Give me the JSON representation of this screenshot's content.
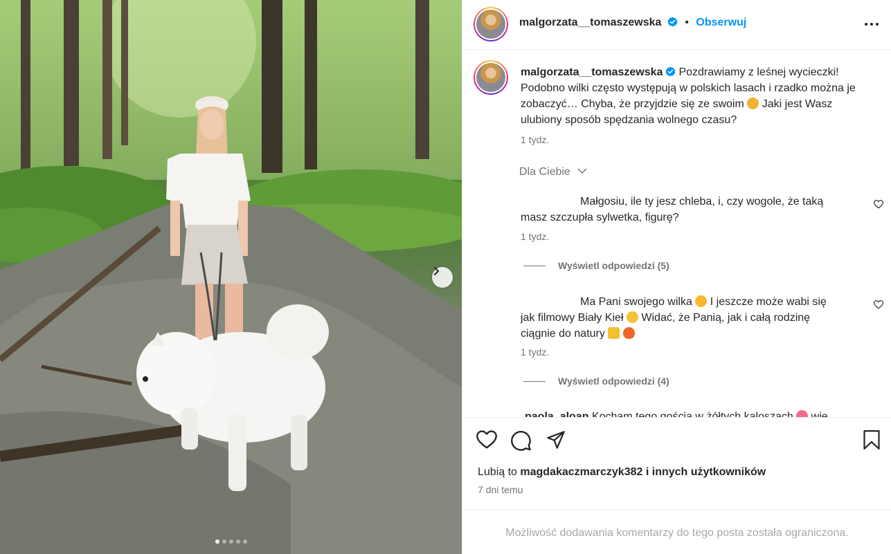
{
  "post": {
    "username": "malgorzata__tomaszewska",
    "follow_label": "Obserwuj",
    "separator": "•",
    "carousel": {
      "total_images": 5,
      "current_index": 1
    }
  },
  "caption": {
    "username": "malgorzata__tomaszewska",
    "text_1": "Pozdrawiamy z leśnej wycieczki! Podobno wilki często występują w polskich lasach i rzadko można je zobaczyć… Chyba, że przyjdzie się ze swoim",
    "text_2": "Jaki jest Wasz ulubiony sposób spędzania wolnego czasu?",
    "time": "1 tydz."
  },
  "section_label": "Dla Ciebie",
  "comments": [
    {
      "text": "Małgosiu, ile ty jesz chleba, i, czy wogole, że taką masz szczupła sylwetka, figurę?",
      "time": "1 tydz.",
      "replies_label": "Wyświetl odpowiedzi (5)"
    },
    {
      "text_1": "Ma Pani swojego wilka",
      "text_2": "I jeszcze może wabi się jak filmowy Biały Kieł",
      "text_3": "Widać, że Panią, jak i całą rodzinę ciągnie do natury",
      "time": "1 tydz.",
      "replies_label": "Wyświetl odpowiedzi (4)"
    },
    {
      "username": "paola_aloan",
      "text": "Kocham tego gościa w żółtych kaloszach",
      "text_end": "wie"
    }
  ],
  "likes": {
    "prefix": "Lubią to",
    "user": "magdakaczmarczyk382",
    "suffix": "i innych użytkowników"
  },
  "post_date": "7 dni temu",
  "restricted_notice": "Możliwość dodawania komentarzy do tego posta została ograniczona.",
  "colors": {
    "accent": "#0095f6",
    "text": "#262626",
    "muted": "#737373",
    "divider": "#efefef"
  },
  "icons": [
    "chevron-right-icon",
    "verified-badge-icon",
    "more-options-icon",
    "heart-icon",
    "comment-icon",
    "share-icon",
    "bookmark-icon"
  ]
}
